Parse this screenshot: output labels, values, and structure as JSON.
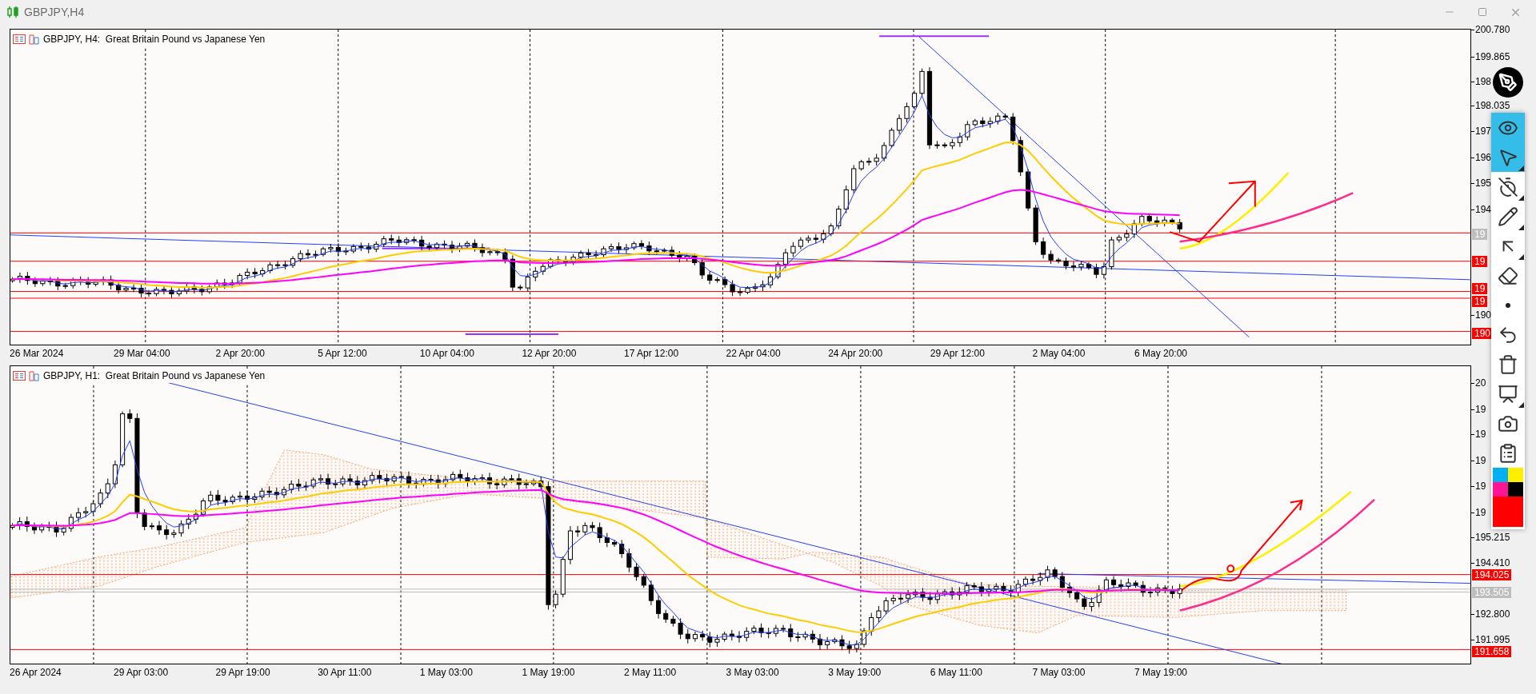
{
  "window": {
    "title": "GBPJPY,H4"
  },
  "charts": [
    {
      "header": "GBPJPY, H4:  Great Britain Pound vs Japanese Yen",
      "price_labels": [
        {
          "text": "200.780",
          "kind": "tick"
        },
        {
          "text": "199.865",
          "kind": "tick"
        },
        {
          "text": "198",
          "kind": "tick"
        },
        {
          "text": "198.035",
          "kind": "tick"
        },
        {
          "text": "197",
          "kind": "tick"
        },
        {
          "text": "196",
          "kind": "tick"
        },
        {
          "text": "195",
          "kind": "tick"
        },
        {
          "text": "194",
          "kind": "tick"
        },
        {
          "text": "19",
          "kind": "gray"
        },
        {
          "text": "19",
          "kind": "red"
        },
        {
          "text": "19",
          "kind": "red"
        },
        {
          "text": "19",
          "kind": "red"
        },
        {
          "text": "190",
          "kind": "tick"
        },
        {
          "text": "190",
          "kind": "red"
        }
      ],
      "time_labels": [
        "26 Mar 2024",
        "29 Mar 04:00",
        "2 Apr 20:00",
        "5 Apr 12:00",
        "10 Apr 04:00",
        "12 Apr 20:00",
        "17 Apr 12:00",
        "22 Apr 04:00",
        "24 Apr 20:00",
        "29 Apr 12:00",
        "2 May 04:00",
        "6 May 20:00"
      ]
    },
    {
      "header": "GBPJPY, H1:  Great Britain Pound vs Japanese Yen",
      "price_labels": [
        {
          "text": "20",
          "kind": "tick"
        },
        {
          "text": "19",
          "kind": "tick"
        },
        {
          "text": "19",
          "kind": "tick"
        },
        {
          "text": "19",
          "kind": "tick"
        },
        {
          "text": "19",
          "kind": "tick"
        },
        {
          "text": "19",
          "kind": "tick"
        },
        {
          "text": "195.215",
          "kind": "tick"
        },
        {
          "text": "194.410",
          "kind": "tick"
        },
        {
          "text": "194.025",
          "kind": "red"
        },
        {
          "text": "193.505",
          "kind": "gray"
        },
        {
          "text": "192.800",
          "kind": "tick"
        },
        {
          "text": "191.995",
          "kind": "tick"
        },
        {
          "text": "191.658",
          "kind": "red"
        }
      ],
      "time_labels": [
        "26 Apr 2024",
        "29 Apr 03:00",
        "29 Apr 19:00",
        "30 Apr 11:00",
        "1 May 03:00",
        "1 May 19:00",
        "2 May 11:00",
        "3 May 03:00",
        "3 May 19:00",
        "6 May 11:00",
        "7 May 03:00",
        "7 May 19:00"
      ]
    }
  ],
  "toolbar": {
    "tools": [
      {
        "kind": "eye",
        "selected": true,
        "submenu": false
      },
      {
        "kind": "cursor",
        "selected": true,
        "submenu": true
      },
      {
        "kind": "stopwatch",
        "selected": false,
        "submenu": true
      },
      {
        "kind": "pencil",
        "selected": false,
        "submenu": true
      },
      {
        "kind": "arrow-line",
        "selected": false,
        "submenu": true
      },
      {
        "kind": "eraser",
        "selected": false,
        "submenu": false
      },
      {
        "kind": "dot",
        "selected": false,
        "submenu": false
      },
      {
        "kind": "undo",
        "selected": false,
        "submenu": false
      },
      {
        "kind": "trash",
        "selected": false,
        "submenu": false
      },
      {
        "kind": "easel",
        "selected": false,
        "submenu": true
      },
      {
        "kind": "camera",
        "selected": false,
        "submenu": false
      },
      {
        "kind": "clipboard",
        "selected": false,
        "submenu": false
      }
    ],
    "palette": [
      {
        "color": "#00b0f0",
        "kind": "small"
      },
      {
        "color": "#ffee00",
        "kind": "small"
      },
      {
        "color": "#ff1493",
        "kind": "small"
      },
      {
        "color": "#000000",
        "kind": "small"
      },
      {
        "color": "#ff0000",
        "kind": "wide"
      }
    ]
  }
}
